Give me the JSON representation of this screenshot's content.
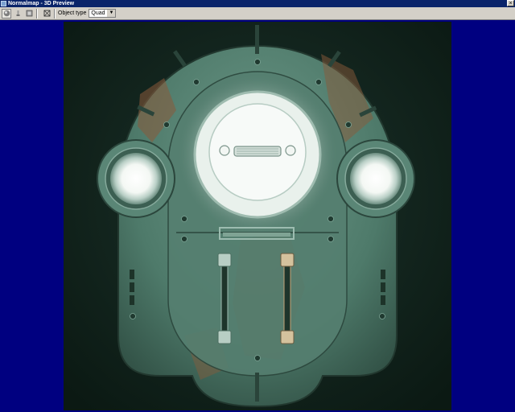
{
  "window": {
    "title": "Normalmap - 3D Preview",
    "close_glyph": "×"
  },
  "toolbar": {
    "object_type_label": "Object type",
    "object_type_value": "Quad",
    "icons": [
      "sphere-icon",
      "light-icon",
      "texture-icon",
      "frame-icon"
    ]
  },
  "colors": {
    "viewport_background": "#000080",
    "metal": "#4e7a6a",
    "rust": "#8a5a3a",
    "light": "#ffffff"
  }
}
